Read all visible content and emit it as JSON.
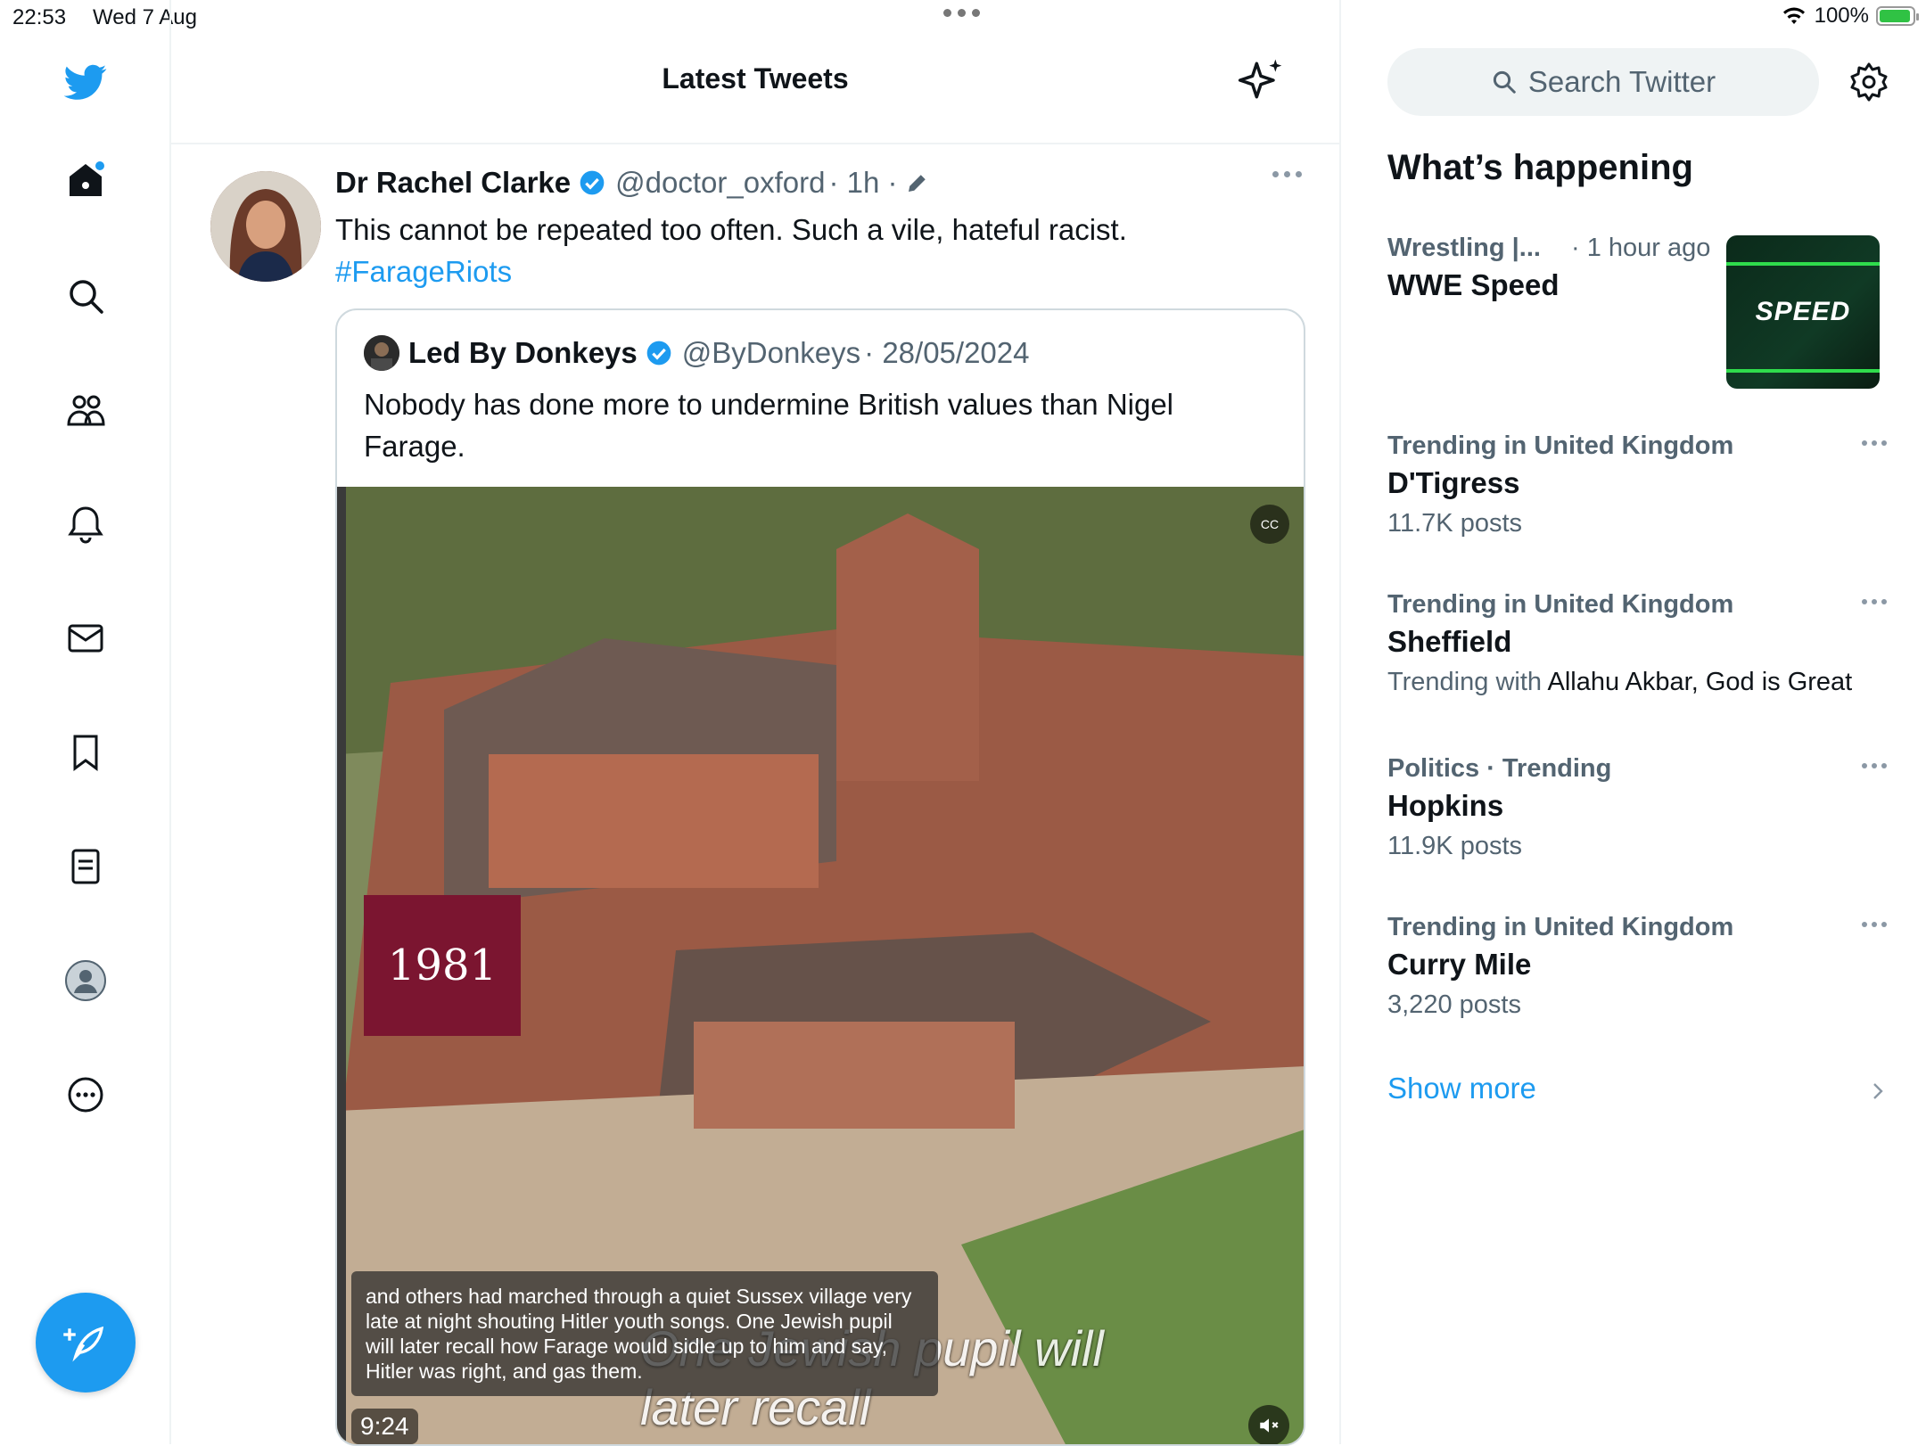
{
  "status_bar": {
    "time": "22:53",
    "date": "Wed 7 Aug",
    "battery": "100%"
  },
  "nav": {
    "items": [
      {
        "name": "home-icon"
      },
      {
        "name": "search-icon"
      },
      {
        "name": "communities-icon"
      },
      {
        "name": "notifications-icon"
      },
      {
        "name": "messages-icon"
      },
      {
        "name": "bookmarks-icon"
      },
      {
        "name": "lists-icon"
      },
      {
        "name": "profile-icon"
      },
      {
        "name": "more-icon"
      }
    ],
    "compose_icon": "compose-icon"
  },
  "main": {
    "title": "Latest Tweets",
    "tweet": {
      "author_name": "Dr Rachel Clarke",
      "author_handle": "@doctor_oxford",
      "time": "· 1h ·",
      "text": "This cannot be repeated too often. Such a vile, hateful racist.",
      "hashtag": "#FarageRiots",
      "quote": {
        "author_name": "Led By Donkeys",
        "author_handle": "@ByDonkeys",
        "date": "· 28/05/2024",
        "text": "Nobody has done more to undermine British values than Nigel Farage.",
        "video": {
          "year_badge": "1981",
          "caption": "and others had marched through a quiet Sussex village very late at night shouting Hitler youth songs. One Jewish pupil will later recall how Farage would sidle up to him and say, Hitler was right, and gas them.",
          "burned_in_text": "One Jewish pupil will later recall",
          "duration": "9:24",
          "cc_label": "CC"
        }
      }
    }
  },
  "sidebar": {
    "search_placeholder": "Search Twitter",
    "whats_happening": "What’s happening",
    "trends": [
      {
        "meta": "Wrestling |...",
        "meta2": "· 1 hour ago",
        "name": "WWE Speed",
        "thumb": "SPEED"
      },
      {
        "meta": "Trending in United Kingdom",
        "name": "D'Tigress",
        "sub": "11.7K posts"
      },
      {
        "meta": "Trending in United Kingdom",
        "name": "Sheffield",
        "sub_prefix": "Trending with",
        "sub_strong": "Allahu Akbar, God is Great"
      },
      {
        "meta": "Politics · Trending",
        "name": "Hopkins",
        "sub": "11.9K posts"
      },
      {
        "meta": "Trending in United Kingdom",
        "name": "Curry Mile",
        "sub": "3,220 posts"
      }
    ],
    "show_more": "Show more"
  },
  "colors": {
    "accent": "#1d9bf0",
    "text": "#0f1419",
    "secondary": "#536471",
    "year_badge": "#7b1530"
  }
}
